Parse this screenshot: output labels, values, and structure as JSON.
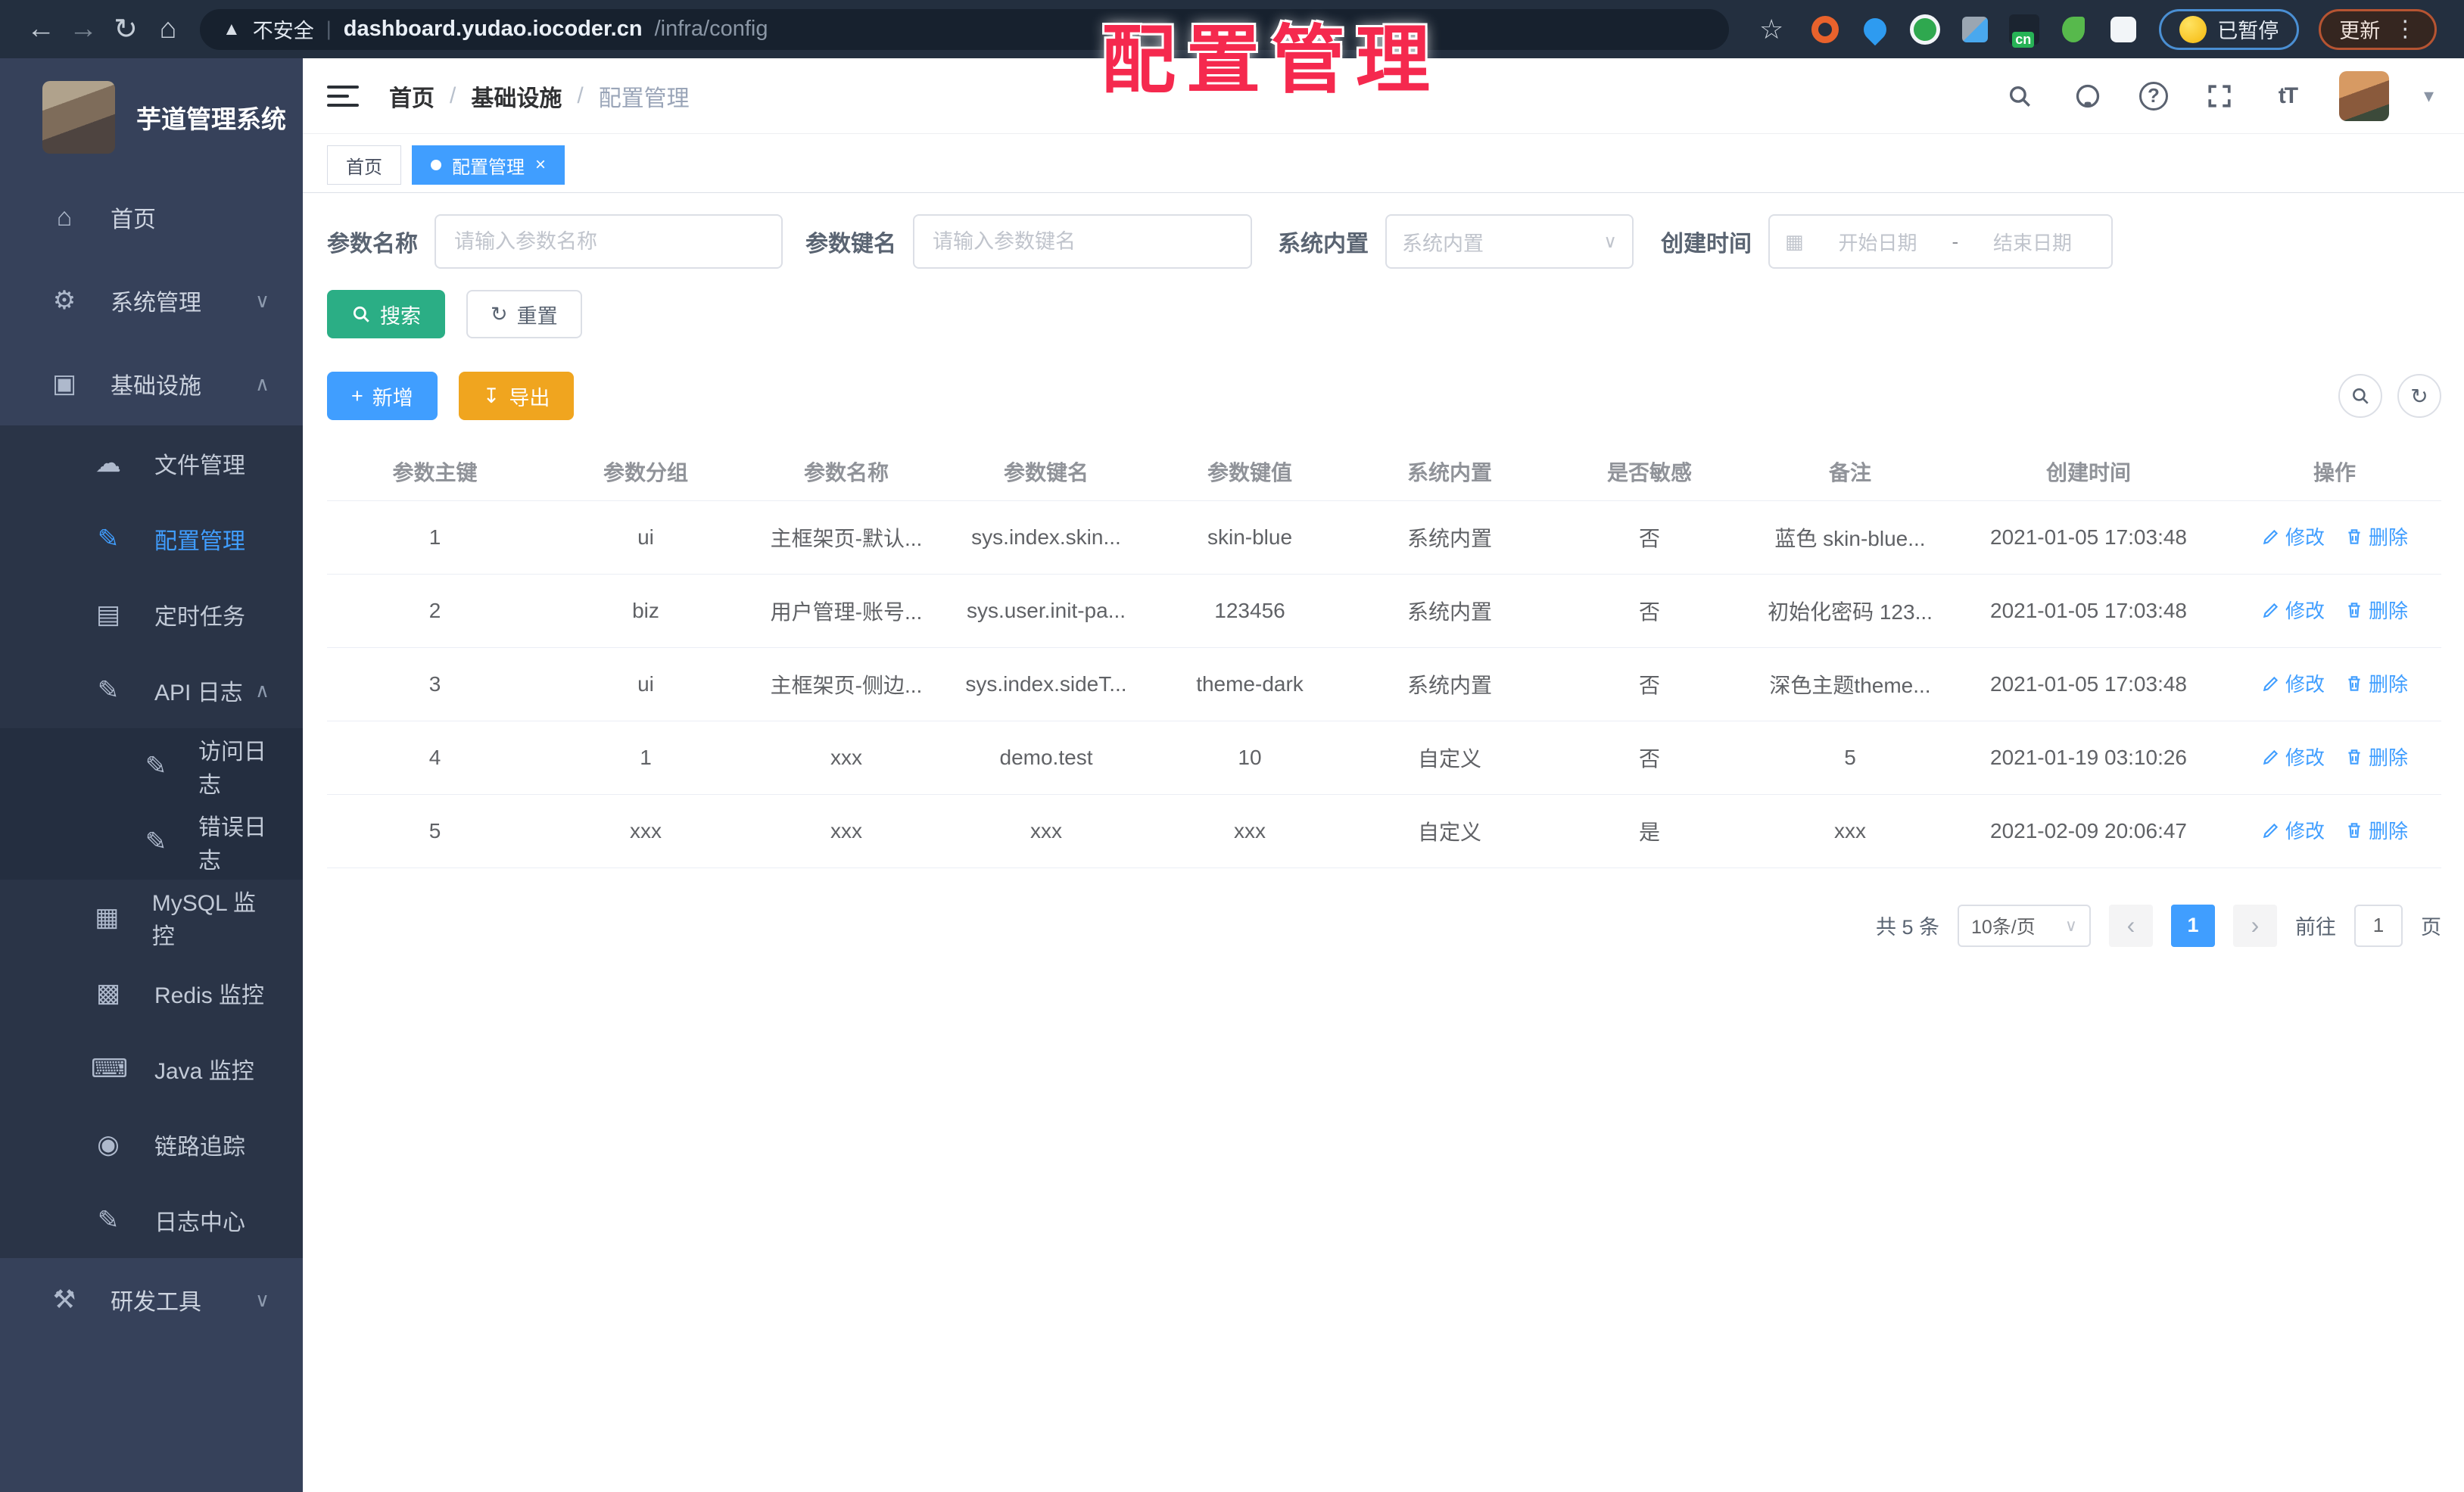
{
  "browser": {
    "security_label": "不安全",
    "url_host": "dashboard.yudao.iocoder.cn",
    "url_path": "/infra/config",
    "paused_badge": "已暂停",
    "update_button": "更新",
    "ext_cn_label": "cn"
  },
  "overlay_title": "配置管理",
  "sidebar": {
    "app_title": "芋道管理系统",
    "items": [
      {
        "label": "首页"
      },
      {
        "label": "系统管理"
      },
      {
        "label": "基础设施"
      },
      {
        "label": "文件管理"
      },
      {
        "label": "配置管理"
      },
      {
        "label": "定时任务"
      },
      {
        "label": "API 日志"
      },
      {
        "label": "访问日志"
      },
      {
        "label": "错误日志"
      },
      {
        "label": "MySQL 监控"
      },
      {
        "label": "Redis 监控"
      },
      {
        "label": "Java 监控"
      },
      {
        "label": "链路追踪"
      },
      {
        "label": "日志中心"
      },
      {
        "label": "研发工具"
      }
    ]
  },
  "breadcrumb": {
    "items": [
      "首页",
      "基础设施",
      "配置管理"
    ],
    "separator": "/"
  },
  "tabs": [
    {
      "label": "首页"
    },
    {
      "label": "配置管理"
    }
  ],
  "filters": {
    "name_label": "参数名称",
    "name_placeholder": "请输入参数名称",
    "key_label": "参数键名",
    "key_placeholder": "请输入参数键名",
    "type_label": "系统内置",
    "type_placeholder": "系统内置",
    "date_label": "创建时间",
    "date_start_placeholder": "开始日期",
    "date_separator": "-",
    "date_end_placeholder": "结束日期"
  },
  "toolbar": {
    "search": "搜索",
    "reset": "重置",
    "add": "新增",
    "export": "导出"
  },
  "table": {
    "headers": [
      "参数主键",
      "参数分组",
      "参数名称",
      "参数键名",
      "参数键值",
      "系统内置",
      "是否敏感",
      "备注",
      "创建时间",
      "操作"
    ],
    "rows": [
      {
        "cells": [
          "1",
          "ui",
          "主框架页-默认...",
          "sys.index.skin...",
          "skin-blue",
          "系统内置",
          "否",
          "蓝色 skin-blue...",
          "2021-01-05 17:03:48"
        ]
      },
      {
        "cells": [
          "2",
          "biz",
          "用户管理-账号...",
          "sys.user.init-pa...",
          "123456",
          "系统内置",
          "否",
          "初始化密码 123...",
          "2021-01-05 17:03:48"
        ]
      },
      {
        "cells": [
          "3",
          "ui",
          "主框架页-侧边...",
          "sys.index.sideT...",
          "theme-dark",
          "系统内置",
          "否",
          "深色主题theme...",
          "2021-01-05 17:03:48"
        ]
      },
      {
        "cells": [
          "4",
          "1",
          "xxx",
          "demo.test",
          "10",
          "自定义",
          "否",
          "5",
          "2021-01-19 03:10:26"
        ]
      },
      {
        "cells": [
          "5",
          "xxx",
          "xxx",
          "xxx",
          "xxx",
          "自定义",
          "是",
          "xxx",
          "2021-02-09 20:06:47"
        ]
      }
    ],
    "edit_label": "修改",
    "delete_label": "删除"
  },
  "pagination": {
    "total": "共 5 条",
    "page_size": "10条/页",
    "prev": "‹",
    "current_page": "1",
    "next": "›",
    "goto_label": "前往",
    "goto_value": "1",
    "page_unit": "页"
  },
  "icons": {
    "back": "←",
    "forward": "→",
    "reload": "↻",
    "home": "⌂",
    "warning": "▲",
    "divider": "|",
    "star": "☆",
    "dots_vertical": "⋮",
    "caret_down": "▾",
    "chevron_down": "∨",
    "chevron_up": "∧",
    "close": "×",
    "dashboard": "⌂",
    "gear": "⚙",
    "monitor": "▣",
    "cloud": "☁",
    "edit": "✎",
    "log": "▤",
    "grid": "▦",
    "layers": "▩",
    "keyboard": "⌨",
    "eye": "◉",
    "tools": "⚒",
    "plus": "+",
    "download": "↧",
    "refresh": "↻",
    "calendar": "▦",
    "question": "?",
    "font_size": "tT"
  },
  "colors": {
    "accent": "#409EFF",
    "search_button": "#2BAE85",
    "export_button": "#F0A51F",
    "sidebar_bg": "#36415A",
    "submenu_bg": "#2A3447",
    "overlay_red": "#F5294E"
  }
}
